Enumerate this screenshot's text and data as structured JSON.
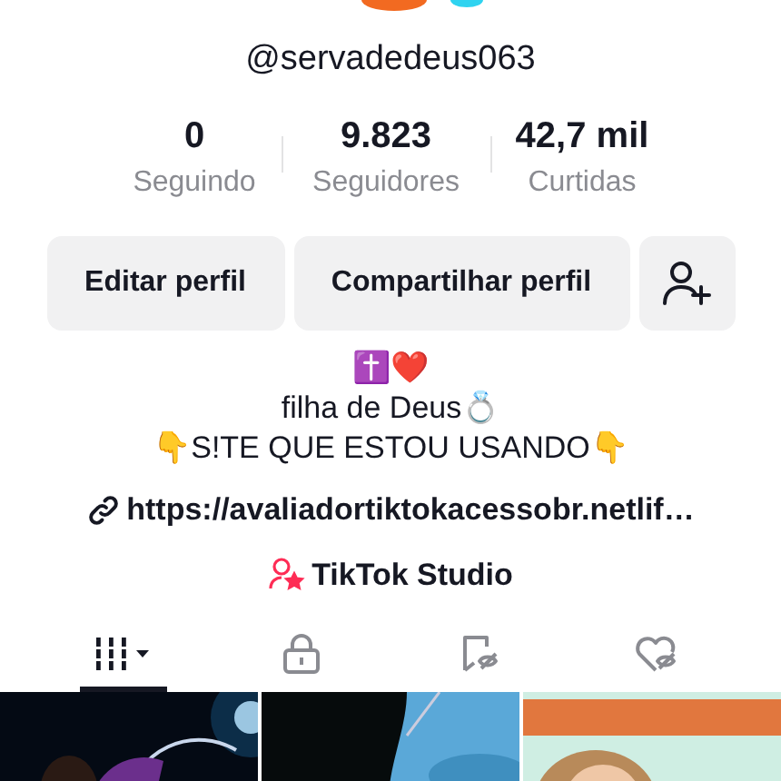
{
  "profile": {
    "username": "@servadedeus063"
  },
  "stats": [
    {
      "value": "0",
      "label": "Seguindo"
    },
    {
      "value": "9.823",
      "label": "Seguidores"
    },
    {
      "value": "42,7 mil",
      "label": "Curtidas"
    }
  ],
  "buttons": [
    {
      "label": "Editar perfil"
    },
    {
      "label": "Compartilhar perfil"
    }
  ],
  "bio": [
    "✝️❤️",
    "filha de Deus💍",
    "👇S!TE QUE ESTOU USANDO👇"
  ],
  "link": "https://avaliadortiktokacessobr.netlif…",
  "studio": "TikTok Studio",
  "tabs": [
    {
      "kind": "grid",
      "selected": true
    },
    {
      "kind": "lock",
      "selected": false
    },
    {
      "kind": "saved",
      "selected": false
    },
    {
      "kind": "liked",
      "selected": false
    }
  ],
  "videos": [
    {
      "kind": "picture"
    },
    {
      "kind": "picture"
    },
    {
      "kind": "picture"
    }
  ]
}
